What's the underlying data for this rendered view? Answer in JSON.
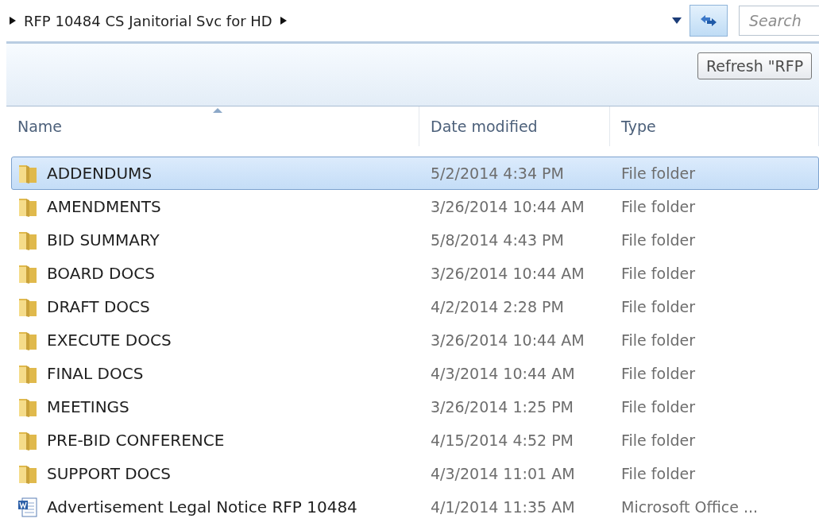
{
  "address_bar": {
    "path": "RFP 10484 CS Janitorial Svc for HD"
  },
  "search": {
    "placeholder": "Search"
  },
  "tooltip": {
    "text": "Refresh \"RFP"
  },
  "table": {
    "columns": [
      {
        "label": "Name",
        "sorted": true
      },
      {
        "label": "Date modified",
        "sorted": false
      },
      {
        "label": "Type",
        "sorted": false
      }
    ],
    "rows": [
      {
        "kind": "folder",
        "name": "ADDENDUMS",
        "date": "5/2/2014 4:34 PM",
        "type": "File folder",
        "selected": true
      },
      {
        "kind": "folder",
        "name": "AMENDMENTS",
        "date": "3/26/2014 10:44 AM",
        "type": "File folder",
        "selected": false
      },
      {
        "kind": "folder",
        "name": "BID SUMMARY",
        "date": "5/8/2014 4:43 PM",
        "type": "File folder",
        "selected": false
      },
      {
        "kind": "folder",
        "name": "BOARD DOCS",
        "date": "3/26/2014 10:44 AM",
        "type": "File folder",
        "selected": false
      },
      {
        "kind": "folder",
        "name": "DRAFT DOCS",
        "date": "4/2/2014 2:28 PM",
        "type": "File folder",
        "selected": false
      },
      {
        "kind": "folder",
        "name": "EXECUTE DOCS",
        "date": "3/26/2014 10:44 AM",
        "type": "File folder",
        "selected": false
      },
      {
        "kind": "folder",
        "name": "FINAL DOCS",
        "date": "4/3/2014 10:44 AM",
        "type": "File folder",
        "selected": false
      },
      {
        "kind": "folder",
        "name": "MEETINGS",
        "date": "3/26/2014 1:25 PM",
        "type": "File folder",
        "selected": false
      },
      {
        "kind": "folder",
        "name": "PRE-BID CONFERENCE",
        "date": "4/15/2014 4:52 PM",
        "type": "File folder",
        "selected": false
      },
      {
        "kind": "folder",
        "name": "SUPPORT DOCS",
        "date": "4/3/2014 11:01 AM",
        "type": "File folder",
        "selected": false
      },
      {
        "kind": "document",
        "name": "Advertisement Legal Notice RFP 10484",
        "date": "4/1/2014 11:35 AM",
        "type": "Microsoft Office ...",
        "selected": false
      }
    ]
  }
}
